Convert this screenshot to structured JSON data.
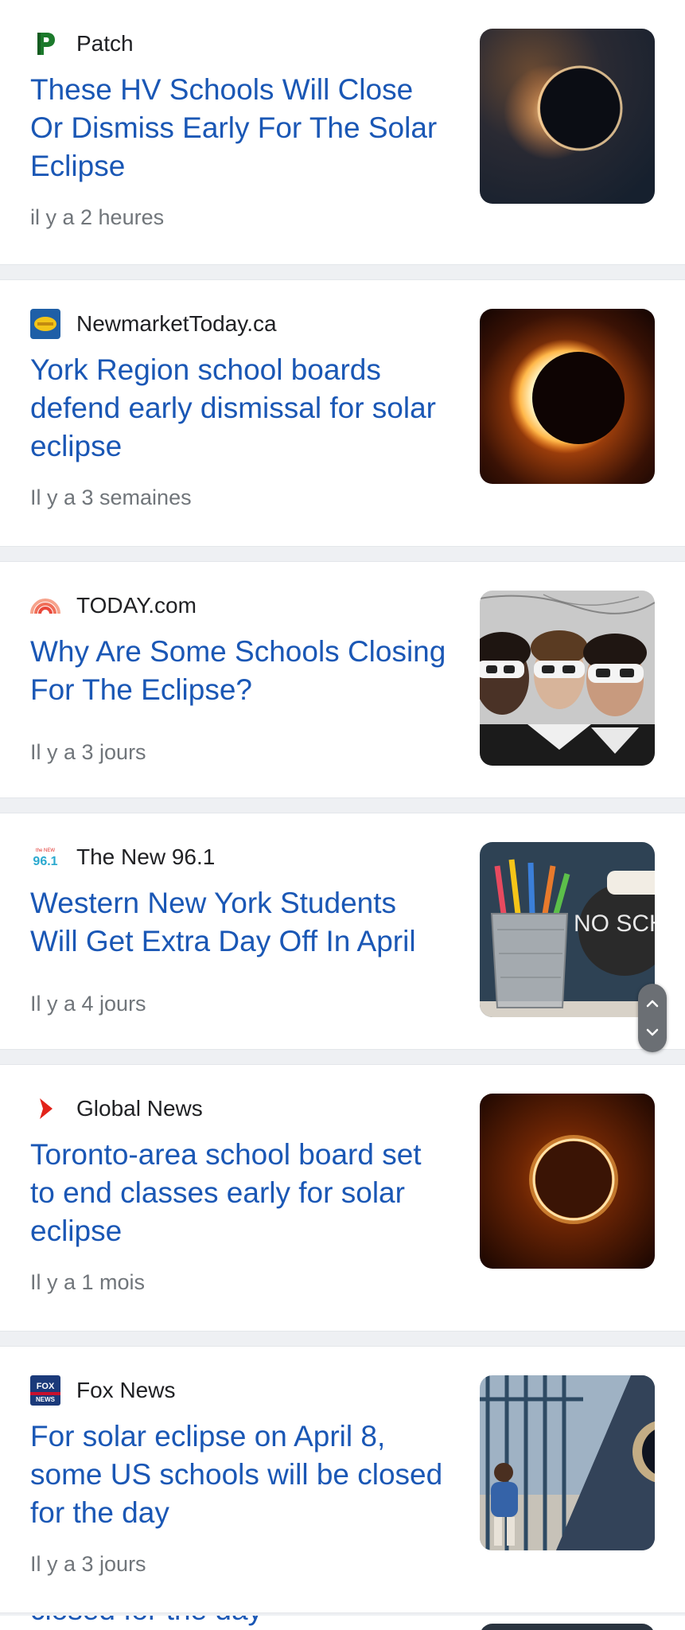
{
  "articles": [
    {
      "source": "Patch",
      "logo_icon": "patch-logo-icon",
      "title": "These HV Schools Will Close Or Dismiss Early For The Solar Eclipse",
      "time": "il y a 2 heures",
      "thumbnail": "solar-eclipse-ring-image"
    },
    {
      "source": "NewmarketToday.ca",
      "logo_icon": "newmarkettoday-logo-icon",
      "title": "York Region school boards defend early dismissal for solar eclipse",
      "time": "Il y a 3 semaines",
      "thumbnail": "solar-eclipse-orange-image"
    },
    {
      "source": "TODAY.com",
      "logo_icon": "today-rainbow-logo-icon",
      "title": "Why Are Some Schools Closing For The Eclipse?",
      "time": "Il y a 3 jours",
      "thumbnail": "students-eclipse-glasses-image"
    },
    {
      "source": "The New 96.1",
      "logo_icon": "new-96-1-logo-icon",
      "title": "Western New York Students Will Get Extra Day Off In April",
      "time": "Il y a 4 jours",
      "thumbnail": "no-school-pencils-image",
      "thumb_text": "NO SCHO"
    },
    {
      "source": "Global News",
      "logo_icon": "global-news-logo-icon",
      "title": "Toronto-area school board set to end classes early for solar eclipse",
      "time": "Il y a 1 mois",
      "thumbnail": "eclipse-ring-dark-image"
    },
    {
      "source": "Fox News",
      "logo_icon": "fox-news-logo-icon",
      "title": "For solar eclipse on April 8, some US schools will be closed for the day",
      "time": "Il y a 3 jours",
      "thumbnail": "student-school-gate-eclipse-image"
    }
  ],
  "partial_article": {
    "title_fragment": "closed for the day"
  },
  "scroll_control": {
    "up_icon": "chevron-up-icon",
    "down_icon": "chevron-down-icon"
  },
  "colors": {
    "title": "#1a57b5",
    "meta": "#70757a",
    "source": "#202124",
    "separator": "#eef0f3"
  }
}
